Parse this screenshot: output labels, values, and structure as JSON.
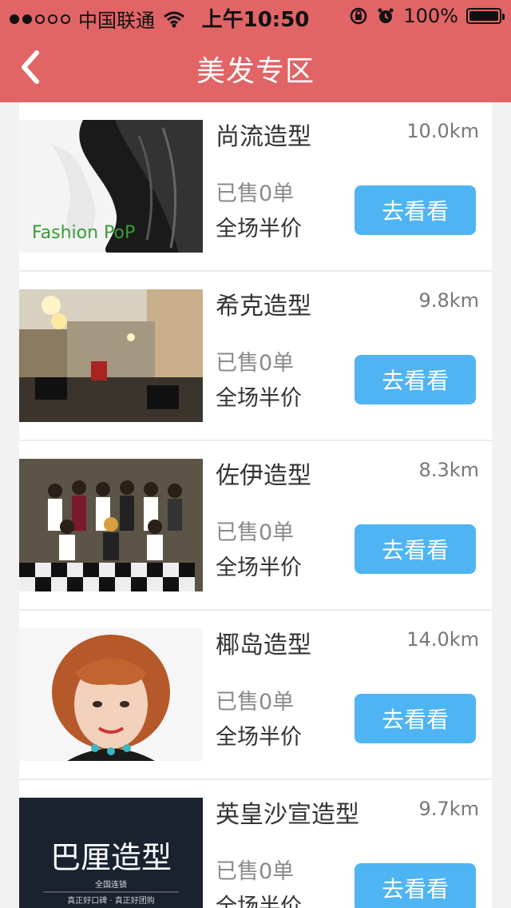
{
  "status_bar": {
    "carrier": "中国联通",
    "time": "上午10:50",
    "battery": "100%",
    "signal_strength": 2
  },
  "nav": {
    "title": "美发专区"
  },
  "colors": {
    "header": "#e16466",
    "button": "#4fb4f3"
  },
  "shops": [
    {
      "name": "尚流造型",
      "distance": "10.0km",
      "sold": "已售0单",
      "promo": "全场半价",
      "button": "去看看",
      "image_text": "Fashion PoP"
    },
    {
      "name": "希克造型",
      "distance": "9.8km",
      "sold": "已售0单",
      "promo": "全场半价",
      "button": "去看看"
    },
    {
      "name": "佐伊造型",
      "distance": "8.3km",
      "sold": "已售0单",
      "promo": "全场半价",
      "button": "去看看"
    },
    {
      "name": "椰岛造型",
      "distance": "14.0km",
      "sold": "已售0单",
      "promo": "全场半价",
      "button": "去看看"
    },
    {
      "name": "英皇沙宣造型",
      "distance": "9.7km",
      "sold": "已售0单",
      "promo": "全场半价",
      "button": "去看看",
      "image_title": "巴厘造型",
      "image_subtitle": "全国连锁",
      "image_tagline": "真正好口碑 · 真正好团购"
    }
  ]
}
